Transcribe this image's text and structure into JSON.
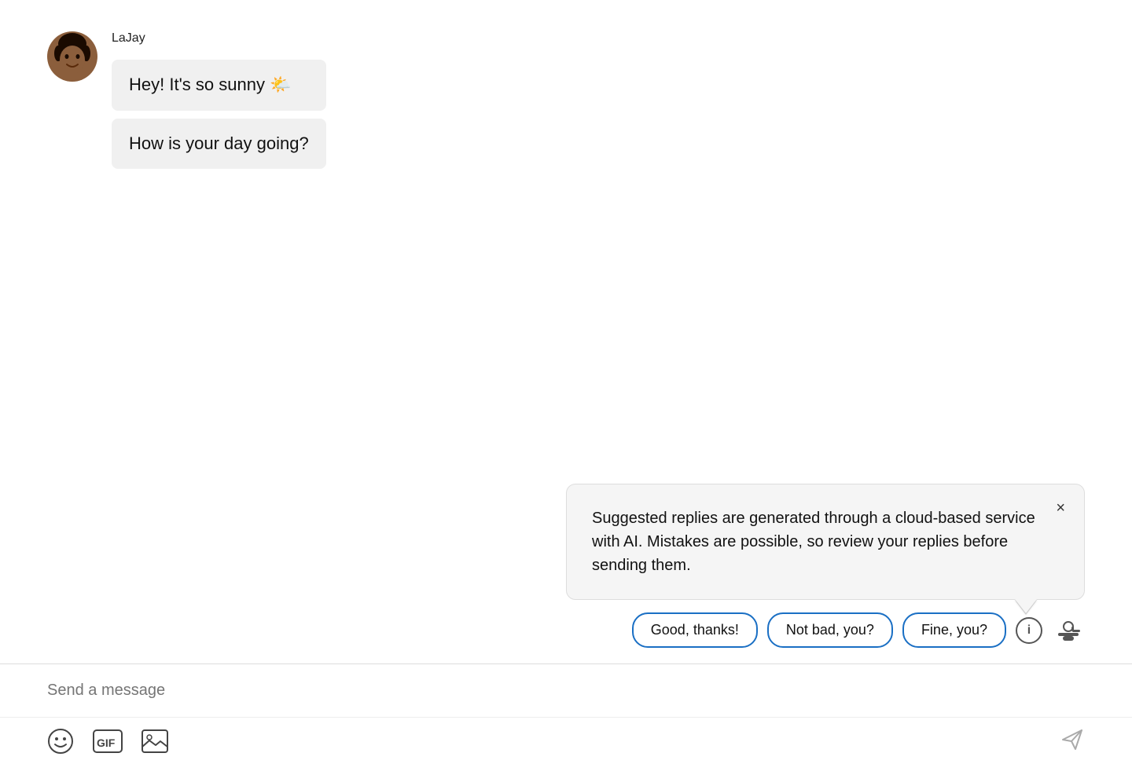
{
  "sender": {
    "name": "LaJay",
    "avatar_label": "LaJay avatar"
  },
  "messages": [
    {
      "id": 1,
      "text": "Hey! It's so sunny 🌤️"
    },
    {
      "id": 2,
      "text": "How is your day going?"
    }
  ],
  "tooltip": {
    "text": "Suggested replies are generated through a cloud-based service with AI. Mistakes are possible, so review your replies before sending them.",
    "close_label": "×"
  },
  "suggested_replies": [
    {
      "id": 1,
      "label": "Good, thanks!"
    },
    {
      "id": 2,
      "label": "Not bad, you?"
    },
    {
      "id": 3,
      "label": "Fine, you?"
    }
  ],
  "input": {
    "placeholder": "Send a message"
  },
  "toolbar": {
    "emoji_label": "Emoji",
    "gif_label": "GIF",
    "image_label": "Image",
    "send_label": "Send"
  },
  "icons": {
    "info": "ℹ",
    "close": "×",
    "send": "➤"
  }
}
